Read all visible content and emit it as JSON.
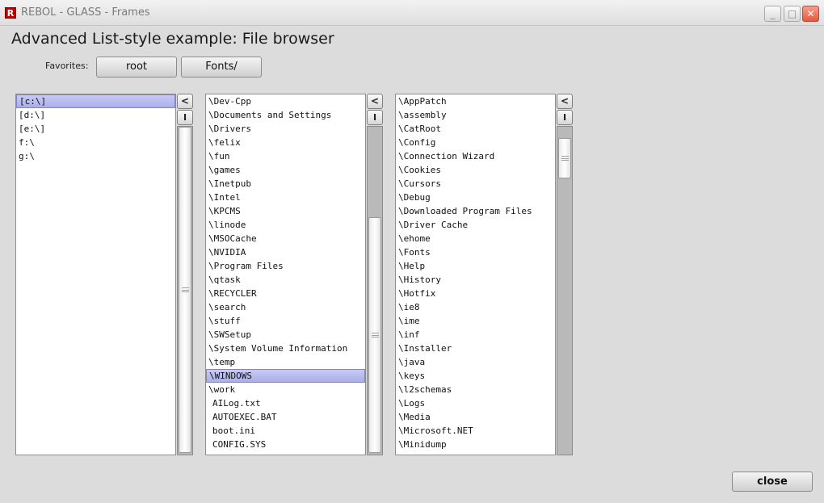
{
  "window": {
    "app_icon": "R",
    "title": "REBOL - GLASS - Frames",
    "min_icon": "minimize-icon",
    "max_icon": "maximize-icon",
    "close_icon": "close-icon",
    "min_glyph": "_",
    "max_glyph": "□",
    "close_glyph": "✕"
  },
  "page_title": "Advanced List-style example: File browser",
  "favorites": {
    "label": "Favorites:",
    "buttons": [
      "root",
      "Fonts/"
    ]
  },
  "panes": [
    {
      "selected": 0,
      "scroll_up": "<",
      "scroll_down": "I",
      "scroll_fraction": 0.0,
      "items": [
        "[c:\\]",
        "[d:\\]",
        "[e:\\]",
        "f:\\",
        "g:\\"
      ]
    },
    {
      "selected": 20,
      "scroll_up": "<",
      "scroll_down": "I",
      "scroll_fraction": 0.55,
      "items": [
        "\\Dev-Cpp",
        "\\Documents and Settings",
        "\\Drivers",
        "\\felix",
        "\\fun",
        "\\games",
        "\\Inetpub",
        "\\Intel",
        "\\KPCMS",
        "\\linode",
        "\\MSOCache",
        "\\NVIDIA",
        "\\Program Files",
        "\\qtask",
        "\\RECYCLER",
        "\\search",
        "\\stuff",
        "\\SWSetup",
        "\\System Volume Information",
        "\\temp",
        "\\WINDOWS",
        "\\work",
        "AILog.txt",
        "AUTOEXEC.BAT",
        "boot.ini",
        "CONFIG.SYS"
      ]
    },
    {
      "selected": -1,
      "scroll_up": "<",
      "scroll_down": "I",
      "scroll_fraction": 0.05,
      "items": [
        "\\AppPatch",
        "\\assembly",
        "\\CatRoot",
        "\\Config",
        "\\Connection Wizard",
        "\\Cookies",
        "\\Cursors",
        "\\Debug",
        "\\Downloaded Program Files",
        "\\Driver Cache",
        "\\ehome",
        "\\Fonts",
        "\\Help",
        "\\History",
        "\\Hotfix",
        "\\ie8",
        "\\ime",
        "\\inf",
        "\\Installer",
        "\\java",
        "\\keys",
        "\\l2schemas",
        "\\Logs",
        "\\Media",
        "\\Microsoft.NET",
        "\\Minidump"
      ]
    }
  ],
  "close_button": "close"
}
